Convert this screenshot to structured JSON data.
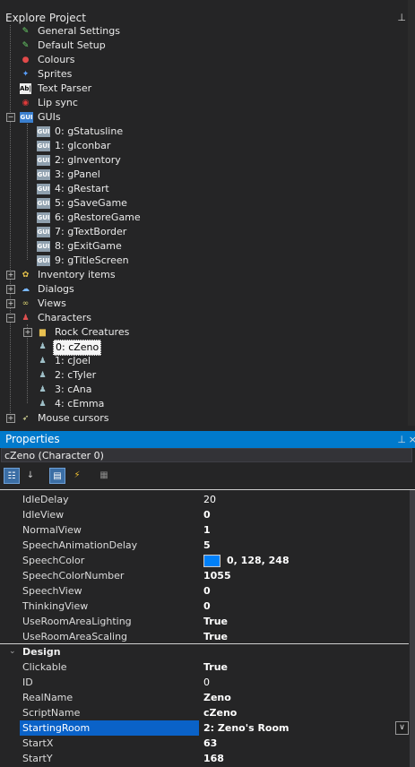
{
  "explorer": {
    "title": "Explore Project",
    "pin_glyph": "📌",
    "close_glyph": "×",
    "items": {
      "general_settings": "General Settings",
      "default_setup": "Default Setup",
      "colours": "Colours",
      "sprites": "Sprites",
      "text_parser": "Text Parser",
      "lip_sync": "Lip sync",
      "guis": "GUIs",
      "gui_0": "0: gStatusline",
      "gui_1": "1: gIconbar",
      "gui_2": "2: gInventory",
      "gui_3": "3: gPanel",
      "gui_4": "4: gRestart",
      "gui_5": "5: gSaveGame",
      "gui_6": "6: gRestoreGame",
      "gui_7": "7: gTextBorder",
      "gui_8": "8: gExitGame",
      "gui_9": "9: gTitleScreen",
      "inventory": "Inventory items",
      "dialogs": "Dialogs",
      "views": "Views",
      "characters": "Characters",
      "rock_creatures": "Rock Creatures",
      "char_0": "0: cZeno",
      "char_1": "1: cJoel",
      "char_2": "2: cTyler",
      "char_3": "3: cAna",
      "char_4": "4: cEmma",
      "mouse_cursors": "Mouse cursors"
    },
    "gui_icon_text": "GUI",
    "text_parser_icon_text": "Ab|",
    "expand_plus": "+",
    "expand_minus": "−"
  },
  "properties": {
    "title": "Properties",
    "selected_object": "cZeno (Character 0)",
    "rows": {
      "idle_delay": {
        "name": "IdleDelay",
        "value": "20"
      },
      "idle_view": {
        "name": "IdleView",
        "value": "0"
      },
      "normal_view": {
        "name": "NormalView",
        "value": "1"
      },
      "speech_anim_delay": {
        "name": "SpeechAnimationDelay",
        "value": "5"
      },
      "speech_color": {
        "name": "SpeechColor",
        "value": "0, 128, 248"
      },
      "speech_color_number": {
        "name": "SpeechColorNumber",
        "value": "1055"
      },
      "speech_view": {
        "name": "SpeechView",
        "value": "0"
      },
      "thinking_view": {
        "name": "ThinkingView",
        "value": "0"
      },
      "use_room_area_lighting": {
        "name": "UseRoomAreaLighting",
        "value": "True"
      },
      "use_room_area_scaling": {
        "name": "UseRoomAreaScaling",
        "value": "True"
      },
      "design_category": "Design",
      "clickable": {
        "name": "Clickable",
        "value": "True"
      },
      "id": {
        "name": "ID",
        "value": "0"
      },
      "real_name": {
        "name": "RealName",
        "value": "Zeno"
      },
      "script_name": {
        "name": "ScriptName",
        "value": "cZeno"
      },
      "starting_room": {
        "name": "StartingRoom",
        "value": "2: Zeno's Room"
      },
      "start_x": {
        "name": "StartX",
        "value": "63"
      },
      "start_y": {
        "name": "StartY",
        "value": "168"
      }
    },
    "speech_color_hex": "#0080f8"
  }
}
